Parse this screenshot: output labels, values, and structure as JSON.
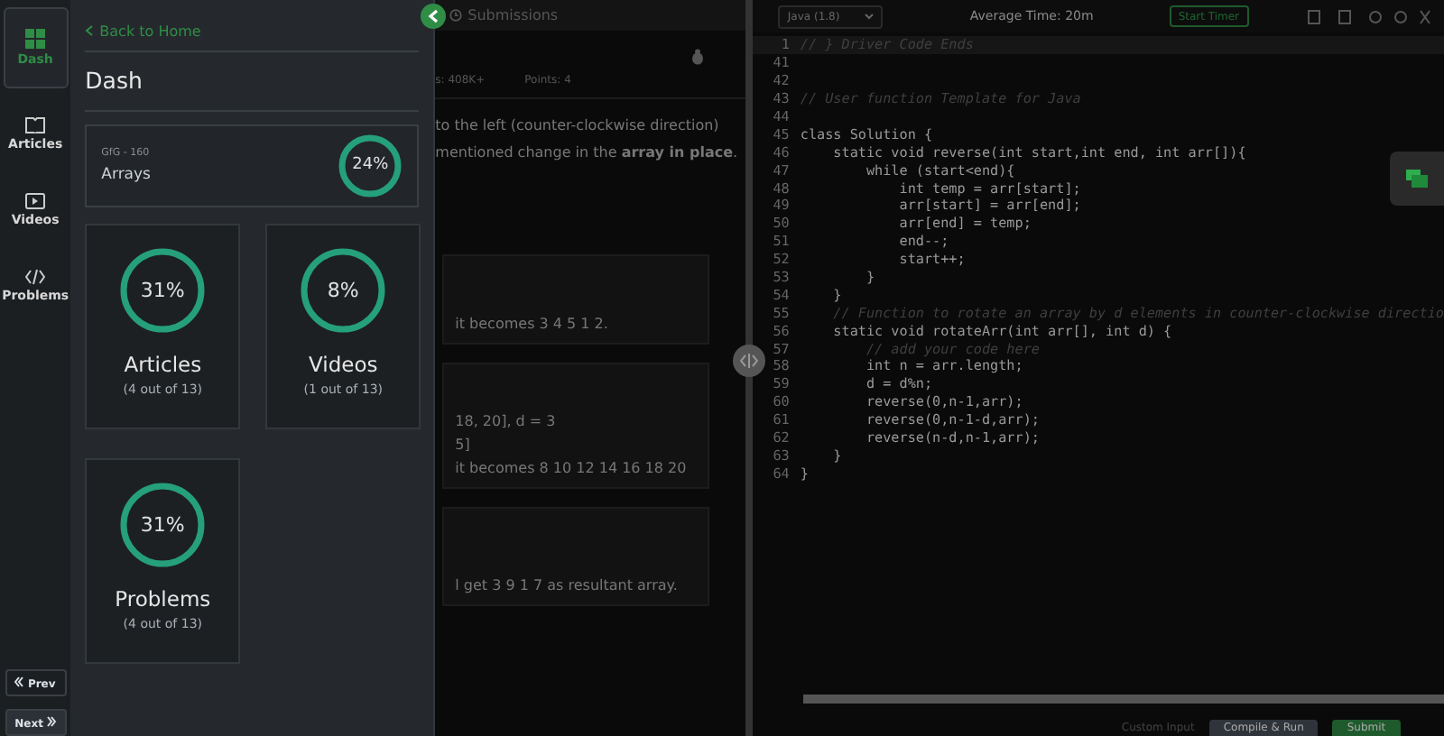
{
  "nav": {
    "items": [
      {
        "label": "Dash",
        "selected": true
      },
      {
        "label": "Articles",
        "selected": false
      },
      {
        "label": "Videos",
        "selected": false
      },
      {
        "label": "Problems",
        "selected": false
      }
    ],
    "prev": "Prev",
    "next": "Next"
  },
  "panel": {
    "back": "Back to Home",
    "title": "Dash",
    "course": {
      "code": "GfG - 160",
      "name": "Arrays",
      "percent": "24%"
    },
    "cards": [
      {
        "percent": "31%",
        "title": "Articles",
        "count": "(4 out of 13)"
      },
      {
        "percent": "8%",
        "title": "Videos",
        "count": "(1 out of 13)"
      },
      {
        "percent": "31%",
        "title": "Problems",
        "count": "(4 out of 13)"
      }
    ]
  },
  "problem": {
    "tab": "Submissions",
    "stats": [
      "s: 408K+",
      "Points: 4"
    ],
    "description": [
      "to the left (counter-clockwise direction)",
      "mentioned change in the **array in place**."
    ],
    "examples": [
      [
        "it becomes 3 4 5 1 2."
      ],
      [
        "18, 20], d = 3",
        "5]",
        "it becomes 8 10 12 14 16 18 20"
      ],
      [
        "l get 3 9 1 7 as resultant array."
      ]
    ]
  },
  "editor": {
    "language": "Java (1.8)",
    "average_time": "Average Time: 20m",
    "timer": "Start Timer",
    "lines": [
      {
        "n": "1",
        "kind": "comment",
        "text": "// } Driver Code Ends"
      },
      {
        "n": "41",
        "kind": "code"
      },
      {
        "n": "42",
        "kind": "code"
      },
      {
        "n": "43",
        "kind": "comment",
        "text": "// User function Template for Java"
      },
      {
        "n": "44",
        "kind": "code"
      },
      {
        "n": "45",
        "kind": "code",
        "text": "class Solution {"
      },
      {
        "n": "46",
        "kind": "code",
        "text": "    static void reverse(int start,int end, int arr[]){"
      },
      {
        "n": "47",
        "kind": "code",
        "text": "        while (start<end){"
      },
      {
        "n": "48",
        "kind": "code",
        "text": "            int temp = arr[start];"
      },
      {
        "n": "49",
        "kind": "code",
        "text": "            arr[start] = arr[end];"
      },
      {
        "n": "50",
        "kind": "code",
        "text": "            arr[end] = temp;"
      },
      {
        "n": "51",
        "kind": "code",
        "text": "            end--;"
      },
      {
        "n": "52",
        "kind": "code",
        "text": "            start++;"
      },
      {
        "n": "53",
        "kind": "code",
        "text": "        }"
      },
      {
        "n": "54",
        "kind": "code",
        "text": "    }"
      },
      {
        "n": "55",
        "kind": "comment",
        "text": "    // Function to rotate an array by d elements in counter-clockwise directio"
      },
      {
        "n": "56",
        "kind": "code",
        "text": "    static void rotateArr(int arr[], int d) {"
      },
      {
        "n": "57",
        "kind": "comment",
        "text": "        // add your code here"
      },
      {
        "n": "58",
        "kind": "code",
        "text": "        int n = arr.length;"
      },
      {
        "n": "59",
        "kind": "code",
        "text": "        d = d%n;"
      },
      {
        "n": "60",
        "kind": "code",
        "text": "        reverse(0,n-1,arr);"
      },
      {
        "n": "61",
        "kind": "code",
        "text": "        reverse(0,n-1-d,arr);"
      },
      {
        "n": "62",
        "kind": "code",
        "text": "        reverse(n-d,n-1,arr);"
      },
      {
        "n": "63",
        "kind": "code",
        "text": "    }"
      },
      {
        "n": "64",
        "kind": "code",
        "text": "}"
      }
    ],
    "custom_input": "Custom Input",
    "compile": "Compile & Run",
    "submit": "Submit"
  }
}
